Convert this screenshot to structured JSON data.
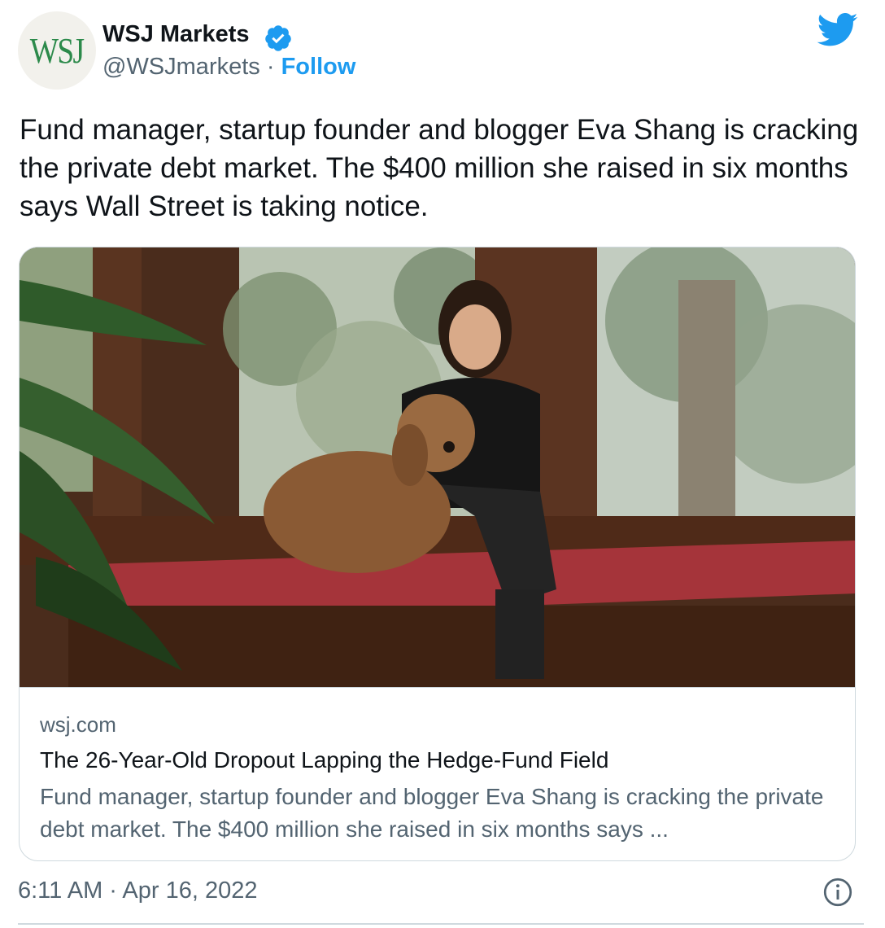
{
  "account": {
    "avatar_text": "WSJ",
    "display_name": "WSJ Markets",
    "handle": "@WSJmarkets",
    "separator": "·",
    "follow_label": "Follow"
  },
  "tweet": {
    "text": "Fund manager, startup founder and blogger Eva Shang is cracking the private debt market. The $400 million she raised in six months says Wall Street is taking notice.",
    "timestamp": "6:11 AM · Apr 16, 2022"
  },
  "card": {
    "domain": "wsj.com",
    "title": "The 26-Year-Old Dropout Lapping the Hedge-Fund Field",
    "description": "Fund manager, startup founder and blogger Eva Shang is cracking the private debt market. The $400 million she raised in six months says ..."
  },
  "colors": {
    "accent": "#1d9bf0",
    "secondary_text": "#536471",
    "wsj_logo_green": "#2c8a4b",
    "border": "#cfd9de"
  },
  "icons": [
    "wsj-logo-avatar",
    "verified-badge-icon",
    "twitter-bird-icon",
    "info-icon"
  ]
}
